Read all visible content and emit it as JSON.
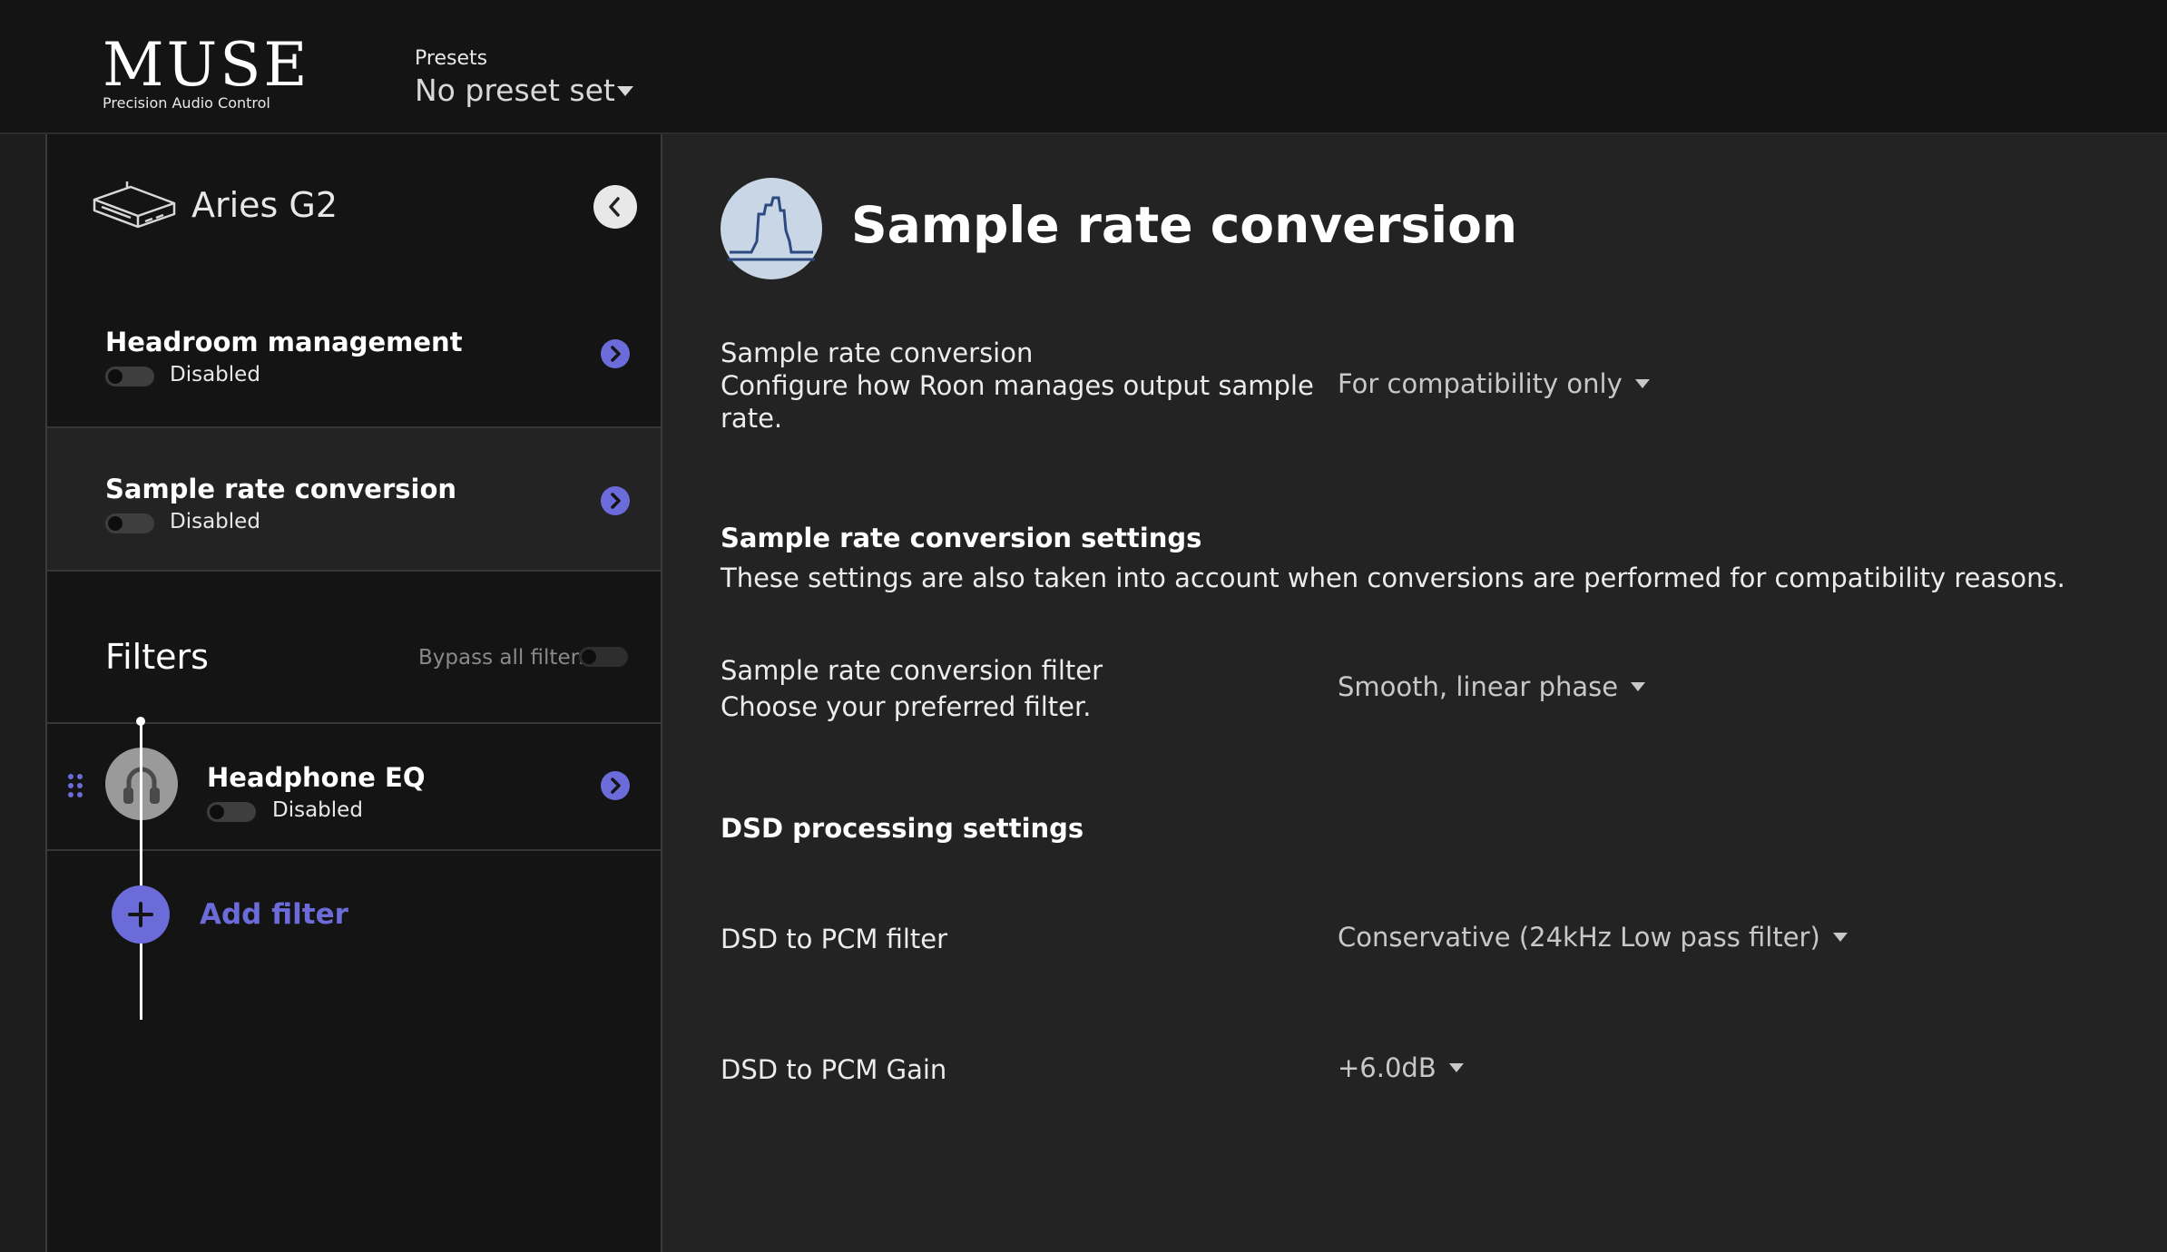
{
  "header": {
    "logo": "MUSE",
    "logo_subtitle": "Precision Audio Control",
    "presets_label": "Presets",
    "presets_value": "No preset set"
  },
  "sidebar": {
    "device_name": "Aries G2",
    "items": [
      {
        "label": "Headroom management",
        "status": "Disabled"
      },
      {
        "label": "Sample rate conversion",
        "status": "Disabled"
      }
    ],
    "filters": {
      "title": "Filters",
      "bypass_label": "Bypass all filters",
      "items": [
        {
          "label": "Headphone EQ",
          "status": "Disabled"
        }
      ],
      "add_label": "Add filter"
    }
  },
  "main": {
    "title": "Sample rate conversion",
    "src_row": {
      "title": "Sample rate conversion",
      "desc_line1": "Configure how Roon manages output sample",
      "desc_line2": "rate.",
      "value": "For compatibility only"
    },
    "src_settings": {
      "title": "Sample rate conversion settings",
      "desc": "These settings are also taken into account when conversions are performed for compatibility reasons."
    },
    "filter_row": {
      "title": "Sample rate conversion filter",
      "desc": "Choose your preferred filter.",
      "value": "Smooth, linear phase"
    },
    "dsd_title": "DSD processing settings",
    "dsd_filter_row": {
      "title": "DSD to PCM filter",
      "value": "Conservative (24kHz Low pass filter)"
    },
    "dsd_gain_row": {
      "title": "DSD to PCM Gain",
      "value": "+6.0dB"
    }
  },
  "colors": {
    "accent": "#6b6bd9",
    "background": "#232323",
    "sidebar": "#141414",
    "selected_row": "#232323"
  }
}
